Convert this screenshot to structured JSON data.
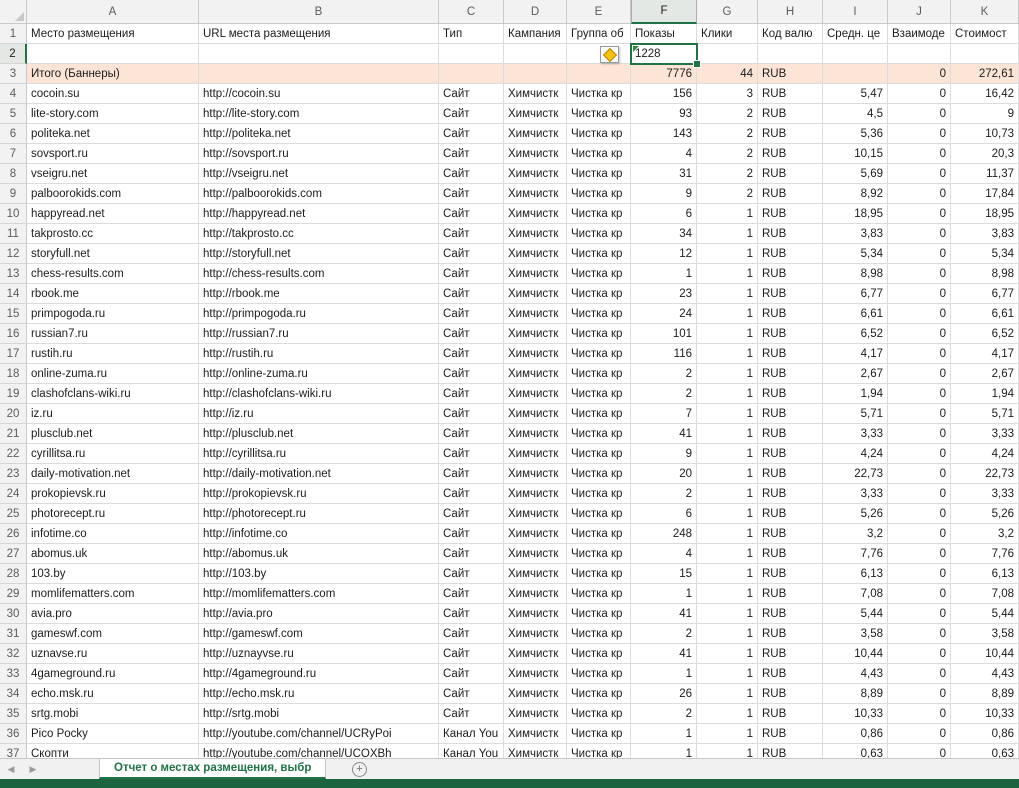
{
  "colors": {
    "accent_green": "#217346",
    "total_row_bg": "#fce4d6",
    "warning_yellow": "#f5c211",
    "gridline": "#dcdcdc"
  },
  "columns": [
    "A",
    "B",
    "C",
    "D",
    "E",
    "F",
    "G",
    "H",
    "I",
    "J",
    "K"
  ],
  "selection": {
    "column": "F",
    "row": 2,
    "value": "1228"
  },
  "icons": {
    "nav_left": "◀",
    "nav_right": "▶",
    "add_sheet": "+"
  },
  "tabbar": {
    "active_tab": "Отчет о местах размещения, выбр"
  },
  "rows": [
    {
      "n": 1,
      "cells": [
        "Место размещения",
        "URL места размещения",
        "Тип",
        "Кампания",
        "Группа об",
        "Показы",
        "Клики",
        "Код валю",
        "Средн. це",
        "Взаимоде",
        "Стоимост"
      ]
    },
    {
      "n": 2,
      "cells": [
        "",
        "",
        "",
        "",
        "",
        "1228",
        "",
        "",
        "",
        "",
        ""
      ]
    },
    {
      "n": 3,
      "type": "total",
      "cells": [
        "Итого (Баннеры)",
        "",
        "",
        "",
        "",
        "7776",
        "44",
        "RUB",
        "",
        "0",
        "272,61"
      ]
    },
    {
      "n": 4,
      "cells": [
        "cocoin.su",
        "http://cocoin.su",
        "Сайт",
        "Химчистк",
        "Чистка кр",
        "156",
        "3",
        "RUB",
        "5,47",
        "0",
        "16,42"
      ]
    },
    {
      "n": 5,
      "cells": [
        "lite-story.com",
        "http://lite-story.com",
        "Сайт",
        "Химчистк",
        "Чистка кр",
        "93",
        "2",
        "RUB",
        "4,5",
        "0",
        "9"
      ]
    },
    {
      "n": 6,
      "cells": [
        "politeka.net",
        "http://politeka.net",
        "Сайт",
        "Химчистк",
        "Чистка кр",
        "143",
        "2",
        "RUB",
        "5,36",
        "0",
        "10,73"
      ]
    },
    {
      "n": 7,
      "cells": [
        "sovsport.ru",
        "http://sovsport.ru",
        "Сайт",
        "Химчистк",
        "Чистка кр",
        "4",
        "2",
        "RUB",
        "10,15",
        "0",
        "20,3"
      ]
    },
    {
      "n": 8,
      "cells": [
        "vseigru.net",
        "http://vseigru.net",
        "Сайт",
        "Химчистк",
        "Чистка кр",
        "31",
        "2",
        "RUB",
        "5,69",
        "0",
        "11,37"
      ]
    },
    {
      "n": 9,
      "cells": [
        "palboorokids.com",
        "http://palboorokids.com",
        "Сайт",
        "Химчистк",
        "Чистка кр",
        "9",
        "2",
        "RUB",
        "8,92",
        "0",
        "17,84"
      ]
    },
    {
      "n": 10,
      "cells": [
        "happyread.net",
        "http://happyread.net",
        "Сайт",
        "Химчистк",
        "Чистка кр",
        "6",
        "1",
        "RUB",
        "18,95",
        "0",
        "18,95"
      ]
    },
    {
      "n": 11,
      "cells": [
        "takprosto.cc",
        "http://takprosto.cc",
        "Сайт",
        "Химчистк",
        "Чистка кр",
        "34",
        "1",
        "RUB",
        "3,83",
        "0",
        "3,83"
      ]
    },
    {
      "n": 12,
      "cells": [
        "storyfull.net",
        "http://storyfull.net",
        "Сайт",
        "Химчистк",
        "Чистка кр",
        "12",
        "1",
        "RUB",
        "5,34",
        "0",
        "5,34"
      ]
    },
    {
      "n": 13,
      "cells": [
        "chess-results.com",
        "http://chess-results.com",
        "Сайт",
        "Химчистк",
        "Чистка кр",
        "1",
        "1",
        "RUB",
        "8,98",
        "0",
        "8,98"
      ]
    },
    {
      "n": 14,
      "cells": [
        "rbook.me",
        "http://rbook.me",
        "Сайт",
        "Химчистк",
        "Чистка кр",
        "23",
        "1",
        "RUB",
        "6,77",
        "0",
        "6,77"
      ]
    },
    {
      "n": 15,
      "cells": [
        "primpogoda.ru",
        "http://primpogoda.ru",
        "Сайт",
        "Химчистк",
        "Чистка кр",
        "24",
        "1",
        "RUB",
        "6,61",
        "0",
        "6,61"
      ]
    },
    {
      "n": 16,
      "cells": [
        "russian7.ru",
        "http://russian7.ru",
        "Сайт",
        "Химчистк",
        "Чистка кр",
        "101",
        "1",
        "RUB",
        "6,52",
        "0",
        "6,52"
      ]
    },
    {
      "n": 17,
      "cells": [
        "rustih.ru",
        "http://rustih.ru",
        "Сайт",
        "Химчистк",
        "Чистка кр",
        "116",
        "1",
        "RUB",
        "4,17",
        "0",
        "4,17"
      ]
    },
    {
      "n": 18,
      "cells": [
        "online-zuma.ru",
        "http://online-zuma.ru",
        "Сайт",
        "Химчистк",
        "Чистка кр",
        "2",
        "1",
        "RUB",
        "2,67",
        "0",
        "2,67"
      ]
    },
    {
      "n": 19,
      "cells": [
        "clashofclans-wiki.ru",
        "http://clashofclans-wiki.ru",
        "Сайт",
        "Химчистк",
        "Чистка кр",
        "2",
        "1",
        "RUB",
        "1,94",
        "0",
        "1,94"
      ]
    },
    {
      "n": 20,
      "cells": [
        "iz.ru",
        "http://iz.ru",
        "Сайт",
        "Химчистк",
        "Чистка кр",
        "7",
        "1",
        "RUB",
        "5,71",
        "0",
        "5,71"
      ]
    },
    {
      "n": 21,
      "cells": [
        "plusclub.net",
        "http://plusclub.net",
        "Сайт",
        "Химчистк",
        "Чистка кр",
        "41",
        "1",
        "RUB",
        "3,33",
        "0",
        "3,33"
      ]
    },
    {
      "n": 22,
      "cells": [
        "cyrillitsa.ru",
        "http://cyrillitsa.ru",
        "Сайт",
        "Химчистк",
        "Чистка кр",
        "9",
        "1",
        "RUB",
        "4,24",
        "0",
        "4,24"
      ]
    },
    {
      "n": 23,
      "cells": [
        "daily-motivation.net",
        "http://daily-motivation.net",
        "Сайт",
        "Химчистк",
        "Чистка кр",
        "20",
        "1",
        "RUB",
        "22,73",
        "0",
        "22,73"
      ]
    },
    {
      "n": 24,
      "cells": [
        "prokopievsk.ru",
        "http://prokopievsk.ru",
        "Сайт",
        "Химчистк",
        "Чистка кр",
        "2",
        "1",
        "RUB",
        "3,33",
        "0",
        "3,33"
      ]
    },
    {
      "n": 25,
      "cells": [
        "photorecept.ru",
        "http://photorecept.ru",
        "Сайт",
        "Химчистк",
        "Чистка кр",
        "6",
        "1",
        "RUB",
        "5,26",
        "0",
        "5,26"
      ]
    },
    {
      "n": 26,
      "cells": [
        "infotime.co",
        "http://infotime.co",
        "Сайт",
        "Химчистк",
        "Чистка кр",
        "248",
        "1",
        "RUB",
        "3,2",
        "0",
        "3,2"
      ]
    },
    {
      "n": 27,
      "cells": [
        "abomus.uk",
        "http://abomus.uk",
        "Сайт",
        "Химчистк",
        "Чистка кр",
        "4",
        "1",
        "RUB",
        "7,76",
        "0",
        "7,76"
      ]
    },
    {
      "n": 28,
      "cells": [
        "103.by",
        "http://103.by",
        "Сайт",
        "Химчистк",
        "Чистка кр",
        "15",
        "1",
        "RUB",
        "6,13",
        "0",
        "6,13"
      ]
    },
    {
      "n": 29,
      "cells": [
        "momlifematters.com",
        "http://momlifematters.com",
        "Сайт",
        "Химчистк",
        "Чистка кр",
        "1",
        "1",
        "RUB",
        "7,08",
        "0",
        "7,08"
      ]
    },
    {
      "n": 30,
      "cells": [
        "avia.pro",
        "http://avia.pro",
        "Сайт",
        "Химчистк",
        "Чистка кр",
        "41",
        "1",
        "RUB",
        "5,44",
        "0",
        "5,44"
      ]
    },
    {
      "n": 31,
      "cells": [
        "gameswf.com",
        "http://gameswf.com",
        "Сайт",
        "Химчистк",
        "Чистка кр",
        "2",
        "1",
        "RUB",
        "3,58",
        "0",
        "3,58"
      ]
    },
    {
      "n": 32,
      "cells": [
        "uznavse.ru",
        "http://uznayvse.ru",
        "Сайт",
        "Химчистк",
        "Чистка кр",
        "41",
        "1",
        "RUB",
        "10,44",
        "0",
        "10,44"
      ]
    },
    {
      "n": 33,
      "cells": [
        "4gameground.ru",
        "http://4gameground.ru",
        "Сайт",
        "Химчистк",
        "Чистка кр",
        "1",
        "1",
        "RUB",
        "4,43",
        "0",
        "4,43"
      ]
    },
    {
      "n": 34,
      "cells": [
        "echo.msk.ru",
        "http://echo.msk.ru",
        "Сайт",
        "Химчистк",
        "Чистка кр",
        "26",
        "1",
        "RUB",
        "8,89",
        "0",
        "8,89"
      ]
    },
    {
      "n": 35,
      "cells": [
        "srtg.mobi",
        "http://srtg.mobi",
        "Сайт",
        "Химчистк",
        "Чистка кр",
        "2",
        "1",
        "RUB",
        "10,33",
        "0",
        "10,33"
      ]
    },
    {
      "n": 36,
      "cells": [
        "Pico Pocky",
        "http://youtube.com/channel/UCRyPoi",
        "Канал You",
        "Химчистк",
        "Чистка кр",
        "1",
        "1",
        "RUB",
        "0,86",
        "0",
        "0,86"
      ]
    },
    {
      "n": 37,
      "cells": [
        "Скопти",
        "http://youtube.com/channel/UCOXBh",
        "Канал You",
        "Химчистк",
        "Чистка кр",
        "1",
        "1",
        "RUB",
        "0,63",
        "0",
        "0,63"
      ]
    }
  ]
}
